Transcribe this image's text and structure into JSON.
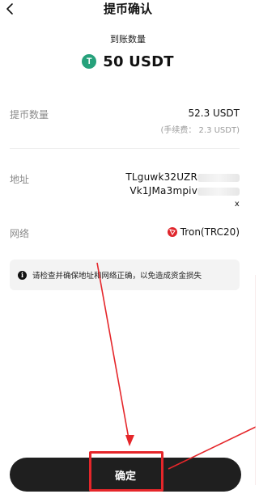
{
  "header": {
    "title": "提币确认"
  },
  "summary": {
    "label": "到账数量",
    "amount": "50 USDT",
    "token_icon_glyph": "T",
    "token_color": "#26a17b"
  },
  "details": {
    "withdraw_label": "提币数量",
    "withdraw_value": "52.3 USDT",
    "fee_text": "(手续费： 2.3 USDT)",
    "address_label": "地址",
    "address_line1": "TLguwk32UZR",
    "address_line2": "Vk1JMa3mpiv",
    "address_line3": "x",
    "network_label": "网络",
    "network_value": "Tron(TRC20)",
    "network_color": "#e0262c"
  },
  "notice": {
    "text": "请检查并确保地址和网络正确，以免造成资金损失"
  },
  "footer": {
    "confirm_label": "确定"
  },
  "annotation_color": "#e5262a"
}
